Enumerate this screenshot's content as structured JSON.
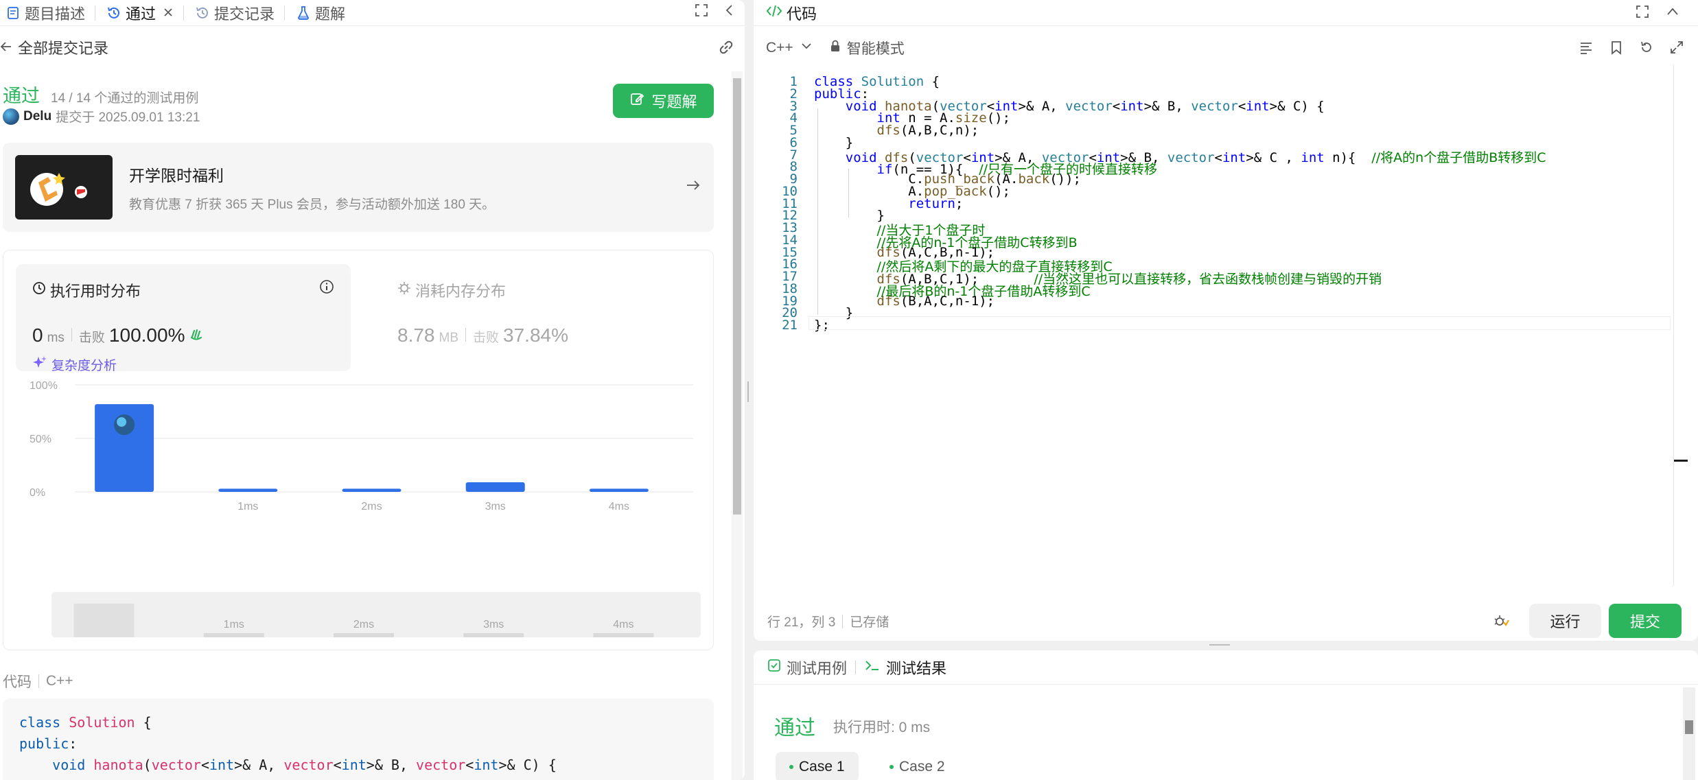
{
  "left_tabs": [
    {
      "label": "题目描述",
      "icon": "description-icon"
    },
    {
      "label": "通过",
      "icon": "history-icon",
      "active": true
    },
    {
      "label": "提交记录",
      "icon": "clock-icon"
    },
    {
      "label": "题解",
      "icon": "flask-icon"
    }
  ],
  "subbar": {
    "back_label": "全部提交记录"
  },
  "result": {
    "status": "通过",
    "cases": "14 / 14 个通过的测试用例",
    "user": "Delu",
    "submitted": "提交于 2025.09.01 13:21",
    "write_solution": "写题解"
  },
  "promo": {
    "title": "开学限时福利",
    "desc": "教育优惠 7 折获 365 天 Plus 会员，参与活动额外加送 180 天。"
  },
  "runtime": {
    "title": "执行用时分布",
    "value": "0",
    "unit": "ms",
    "beat_label": "击败",
    "beat_value": "100.00%",
    "complexity": "复杂度分析"
  },
  "memory": {
    "title": "消耗内存分布",
    "value": "8.78",
    "unit": "MB",
    "beat_label": "击败",
    "beat_value": "37.84%"
  },
  "chart_data": {
    "type": "bar",
    "categories": [
      "",
      "1ms",
      "2ms",
      "3ms",
      "4ms"
    ],
    "values": [
      82,
      3,
      3,
      9,
      3
    ],
    "ylim": [
      0,
      100
    ],
    "ytick_labels": [
      "100%",
      "50%",
      "0%"
    ],
    "grid": true,
    "colors": {
      "bar": "#2f6fe8"
    }
  },
  "range_labels": [
    "1ms",
    "2ms",
    "3ms",
    "4ms"
  ],
  "code_label": {
    "title": "代码",
    "lang": "C++"
  },
  "preview_lines": [
    "class Solution {",
    "public:",
    "    void hanota(vector<int>& A, vector<int>& B, vector<int>& C) {",
    "        int n = A.size();"
  ],
  "editor": {
    "title": "代码",
    "lang": "C++",
    "mode": "智能模式",
    "status_pos": "行 21，列 3",
    "status_saved": "已存储",
    "run": "运行",
    "submit": "提交"
  },
  "code_lines": [
    "class Solution {",
    "public:",
    "    void hanota(vector<int>& A, vector<int>& B, vector<int>& C) {",
    "        int n = A.size();",
    "        dfs(A,B,C,n);",
    "    }",
    "    void dfs(vector<int>& A, vector<int>& B, vector<int>& C , int n){  //将A的n个盘子借助B转移到C",
    "        if(n == 1){  //只有一个盘子的时候直接转移",
    "            C.push_back(A.back());",
    "            A.pop_back();",
    "            return;",
    "        }",
    "        //当大于1个盘子时",
    "        //先将A的n-1个盘子借助C转移到B",
    "        dfs(A,C,B,n-1);",
    "        //然后将A剩下的最大的盘子直接转移到C",
    "        dfs(A,B,C,1);       //当然这里也可以直接转移，省去函数栈帧创建与销毁的开销",
    "        //最后将B的n-1个盘子借助A转移到C",
    "        dfs(B,A,C,n-1);",
    "    }",
    "};"
  ],
  "tests": {
    "tab_cases": "测试用例",
    "tab_result": "测试结果",
    "status": "通过",
    "time": "执行用时: 0 ms",
    "cases": [
      "Case 1",
      "Case 2"
    ]
  },
  "colors": {
    "green": "#2db55d",
    "blue": "#2f6fe8",
    "purple": "#6c5ce7"
  }
}
